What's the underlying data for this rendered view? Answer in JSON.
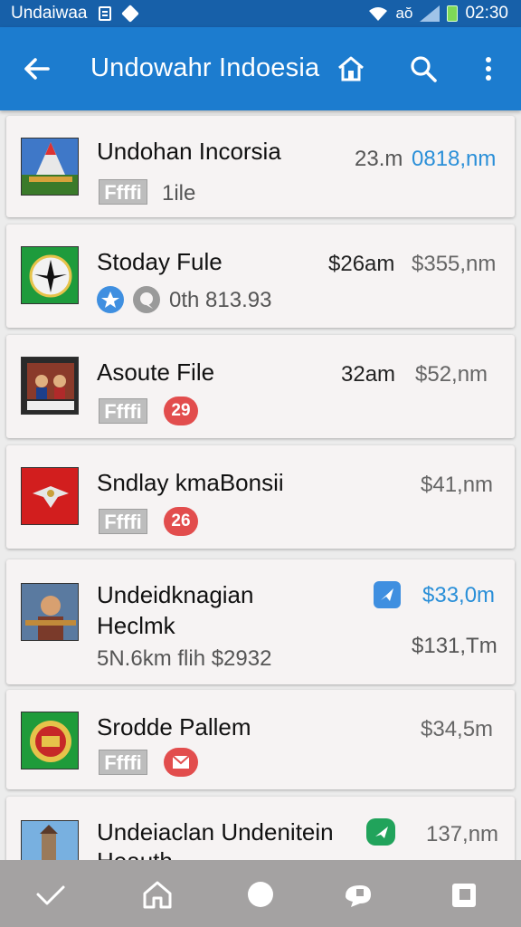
{
  "status_bar": {
    "carrier": "Undaiwaa",
    "clock": "02:30",
    "network": "aŏ"
  },
  "app_bar": {
    "title": "Undowahr Indoesia"
  },
  "items": [
    {
      "name": "Undohan Incorsia",
      "tag": "Ffffi",
      "sub": "1ile",
      "time": "23.m",
      "price": "0818,nm",
      "price_color": "#2a8fd8"
    },
    {
      "name": "Stoday Fule",
      "sub": "0th 813.93",
      "time": "$26am",
      "price": "$355,nm"
    },
    {
      "name": "Asoute File",
      "tag": "Ffffi",
      "badge": "29",
      "time": "32am",
      "price": "$52,nm"
    },
    {
      "name": "Sndlay kmaBonsii",
      "tag": "Ffffi",
      "badge": "26",
      "price": "$41,nm"
    },
    {
      "name": "Undeidknagian",
      "name2": "Heclmk",
      "sub": "5N.6km flih $2932",
      "price": "$33,0m",
      "price2": "$131,Tm",
      "price_color": "#2a8fd8"
    },
    {
      "name": "Srodde Pallem",
      "tag": "Ffffi",
      "price": "$34,5m"
    },
    {
      "name": "Undeiaclan Undenitein",
      "name2": "Heauth",
      "price": "137,nm"
    }
  ],
  "colors": {
    "appbar": "#1c7ccf",
    "statusbar": "#1760a9",
    "badge_red": "#e24d4d",
    "accent_blue": "#2a8fd8",
    "icon_green": "#21a35b"
  }
}
